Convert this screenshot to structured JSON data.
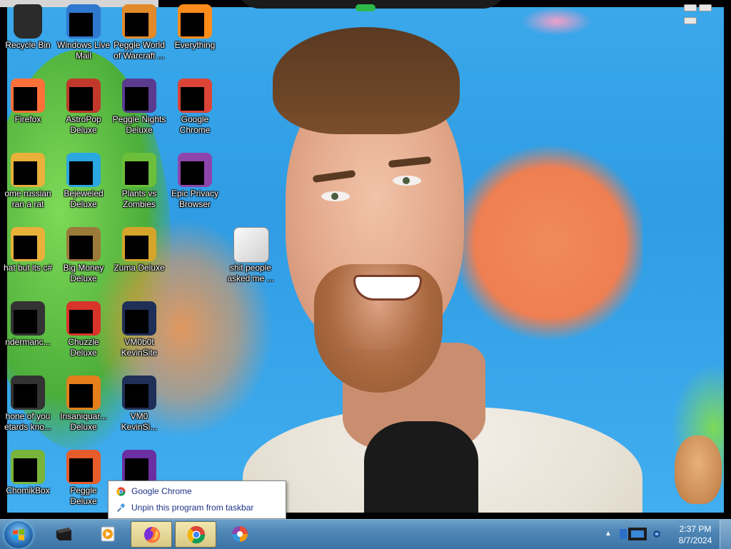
{
  "desktop": {
    "icons": [
      {
        "label": "Recycle Bin",
        "icon": "recycle-bin-icon",
        "redacted": false
      },
      {
        "label": "Windows Live Mail",
        "icon": "windows-live-mail-icon",
        "redacted": true
      },
      {
        "label": "Peggle World of Warcraft ...",
        "icon": "peggle-wow-icon",
        "redacted": true
      },
      {
        "label": "Everything",
        "icon": "everything-icon",
        "redacted": true
      },
      {
        "label": "Firefox",
        "icon": "firefox-icon",
        "redacted": true
      },
      {
        "label": "AstroPop Deluxe",
        "icon": "astropop-icon",
        "redacted": true
      },
      {
        "label": "Peggle Nights Deluxe",
        "icon": "peggle-nights-icon",
        "redacted": true
      },
      {
        "label": "Google Chrome",
        "icon": "chrome-icon",
        "redacted": true
      },
      {
        "label": "ome russian ran a rat",
        "icon": "file-icon",
        "redacted": true
      },
      {
        "label": "Bejeweled Deluxe",
        "icon": "bejeweled-icon",
        "redacted": true
      },
      {
        "label": "Plants vs Zombies",
        "icon": "plants-vs-zombies-icon",
        "redacted": true
      },
      {
        "label": "Epic Privacy Browser",
        "icon": "epic-browser-icon",
        "redacted": true
      },
      {
        "label": "hat but its c#",
        "icon": "file-icon",
        "redacted": true
      },
      {
        "label": "Big Money Deluxe",
        "icon": "big-money-icon",
        "redacted": true
      },
      {
        "label": "Zuma Deluxe",
        "icon": "zuma-icon",
        "redacted": true
      },
      {
        "label": "shit people asked me ...",
        "icon": "folder-icon",
        "redacted": false
      },
      {
        "label": "ndermanc...",
        "icon": "app-icon",
        "redacted": true
      },
      {
        "label": "Chuzzle Deluxe",
        "icon": "chuzzle-icon",
        "redacted": true
      },
      {
        "label": "VM0b0t KevinSite",
        "icon": "vm-icon",
        "redacted": true
      },
      {
        "label": "hone of you etards kno...",
        "icon": "app-icon",
        "redacted": true
      },
      {
        "label": "Insaniquar... Deluxe",
        "icon": "insaniquarium-icon",
        "redacted": true
      },
      {
        "label": "VM0 KevinSi...",
        "icon": "vm-icon",
        "redacted": true
      },
      {
        "label": "ChomikBox",
        "icon": "chomikbox-icon",
        "redacted": true
      },
      {
        "label": "Peggle Deluxe",
        "icon": "peggle-icon",
        "redacted": true
      },
      {
        "label": "",
        "icon": "visual-studio-icon",
        "redacted": true
      }
    ]
  },
  "jumplist": {
    "items": [
      {
        "label": "Google Chrome",
        "icon": "chrome-icon"
      },
      {
        "label": "Unpin this program from taskbar",
        "icon": "unpin-icon"
      }
    ]
  },
  "taskbar": {
    "pinned": [
      {
        "icon": "cmd-icon",
        "active": false
      },
      {
        "icon": "media-player-icon",
        "active": false
      },
      {
        "icon": "firefox-icon",
        "active": true
      },
      {
        "icon": "chrome-icon",
        "active": true
      },
      {
        "icon": "epic-browser-icon",
        "active": false
      }
    ],
    "clock": {
      "time": "2:37 PM",
      "date": "8/7/2024"
    }
  },
  "colors": {
    "taskbar": "#4e86b6",
    "jumplist_text": "#1e3287",
    "wallpaper": "#3aa8ea"
  }
}
